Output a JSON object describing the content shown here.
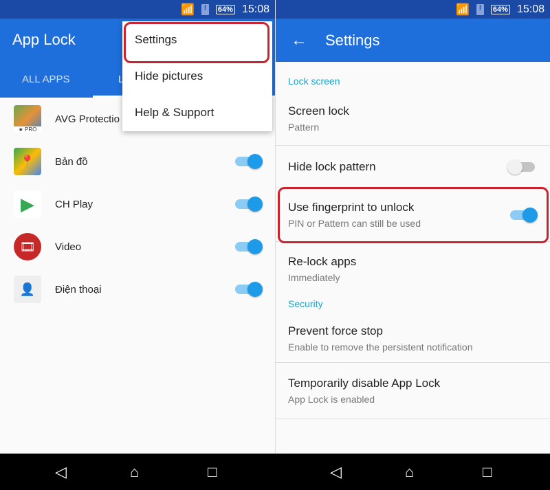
{
  "status": {
    "time": "15:08",
    "battery": "64%"
  },
  "left": {
    "title": "App Lock",
    "tabs": [
      "ALL APPS",
      "L"
    ],
    "apps": [
      {
        "name": "AVG Protectio",
        "badge": "★ PRO",
        "color": "#6aa84f",
        "toggle": null
      },
      {
        "name": "Bản đồ",
        "color": "#34a853",
        "toggle": true
      },
      {
        "name": "CH Play",
        "color": "#ffffff",
        "toggle": true
      },
      {
        "name": "Video",
        "color": "#c62828",
        "toggle": true
      },
      {
        "name": "Điện thoại",
        "color": "#eeeeee",
        "toggle": true
      }
    ],
    "menu": [
      "Settings",
      "Hide pictures",
      "Help & Support"
    ]
  },
  "right": {
    "title": "Settings",
    "sections": [
      {
        "header": "Lock screen",
        "items": [
          {
            "title": "Screen lock",
            "subtitle": "Pattern"
          },
          {
            "title": "Hide lock pattern",
            "toggle": false
          },
          {
            "title": "Use fingerprint to unlock",
            "subtitle": "PIN or Pattern can still be used",
            "toggle": true
          },
          {
            "title": "Re-lock apps",
            "subtitle": "Immediately"
          }
        ]
      },
      {
        "header": "Security",
        "items": [
          {
            "title": "Prevent force stop",
            "subtitle": "Enable to remove the persistent notification"
          },
          {
            "title": "Temporarily disable App Lock",
            "subtitle": "App Lock is enabled"
          }
        ]
      }
    ]
  },
  "highlight_color": "#c8232f"
}
